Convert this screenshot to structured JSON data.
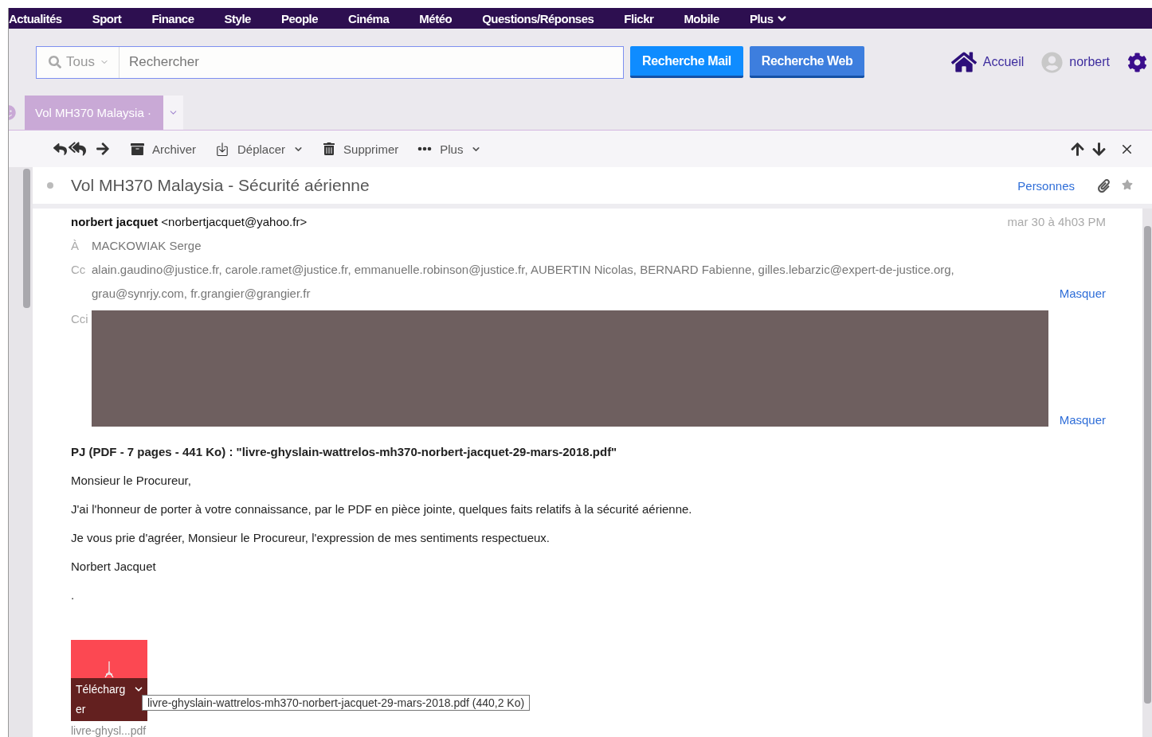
{
  "nav": {
    "items": [
      "Actualités",
      "Sport",
      "Finance",
      "Style",
      "People",
      "Cinéma",
      "Météo",
      "Questions/Réponses",
      "Flickr",
      "Mobile"
    ],
    "more": "Plus"
  },
  "search": {
    "scope": "Tous",
    "placeholder": "Rechercher",
    "buttons": [
      "Recherche Mail",
      "Recherche Web"
    ]
  },
  "header_links": {
    "home": "Accueil",
    "user": "norbert"
  },
  "tabs": [
    {
      "label": "Vol MH370 Malaysia ·",
      "selected": true
    }
  ],
  "toolbar": [
    {
      "kind": "archive",
      "label": "Archiver",
      "menu": false
    },
    {
      "kind": "move",
      "label": "Déplacer",
      "menu": true
    },
    {
      "kind": "delete",
      "label": "Supprimer",
      "menu": false
    },
    {
      "kind": "more",
      "label": "Plus",
      "menu": true
    }
  ],
  "message": {
    "subject": "Vol MH370 Malaysia - Sécurité aérienne",
    "people_link": "Personnes",
    "from_name": "norbert jacquet",
    "from_email": "<norbertjacquet@yahoo.fr>",
    "date": "mar 30 à 4h03 PM",
    "to_label": "À",
    "to": "MACKOWIAK Serge",
    "cc_label": "Cc",
    "cc_lines": [
      "alain.gaudino@justice.fr, carole.ramet@justice.fr, emmanuelle.robinson@justice.fr, AUBERTIN Nicolas, BERNARD Fabienne, gilles.lebarzic@expert-de-justice.org,",
      "grau@synrjy.com, fr.grangier@grangier.fr"
    ],
    "cc_hide": "Masquer",
    "bcc_label": "Cci",
    "bcc_hide": "Masquer",
    "body": [
      {
        "kind": "bold",
        "text": "PJ (PDF - 7 pages - 441 Ko) : \"livre-ghyslain-wattrelos-mh370-norbert-jacquet-29-mars-2018.pdf\""
      },
      {
        "kind": "text",
        "text": "Monsieur le Procureur,"
      },
      {
        "kind": "text",
        "text": "J'ai l'honneur de porter à votre connaissance, par le PDF en pièce jointe, quelques faits relatifs à la sécurité aérienne."
      },
      {
        "kind": "text",
        "text": "Je vous prie d'agréer, Monsieur le Procureur, l'expression de mes sentiments respectueux."
      },
      {
        "kind": "text",
        "text": "Norbert Jacquet"
      },
      {
        "kind": "text",
        "text": "."
      }
    ],
    "attachment": {
      "download": "Télécharger",
      "tooltip": "livre-ghyslain-wattrelos-mh370-norbert-jacquet-29-mars-2018.pdf (440,2 Ko)",
      "filename": "livre-ghysl...pdf"
    }
  }
}
